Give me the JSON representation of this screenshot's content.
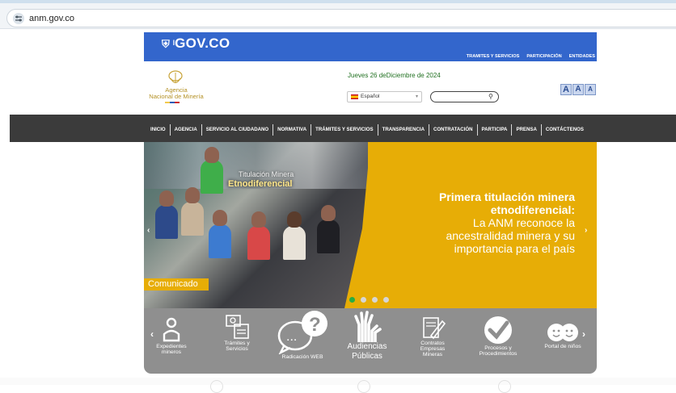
{
  "browser": {
    "url": "anm.gov.co"
  },
  "gov_bar": {
    "logo_text": "GOV.CO",
    "links": [
      "TRAMITES Y SERVICIOS",
      "PARTICIPACIÓN",
      "ENTIDADES"
    ]
  },
  "header": {
    "agency_name_line1": "Agencia",
    "agency_name_line2": "Nacional de Minería",
    "date": "Jueves 26 deDiciembre de 2024",
    "language": "Español",
    "font_sizes": [
      "A",
      "A",
      "A"
    ]
  },
  "nav": {
    "items": [
      "INICIO",
      "AGENCIA",
      "SERVICIO AL CIUDADANO",
      "NORMATIVA",
      "TRÁMITES Y SERVICIOS",
      "TRANSPARENCIA",
      "CONTRATACIÓN",
      "PARTICIPA",
      "PRENSA",
      "CONTÁCTENOS"
    ]
  },
  "banner": {
    "photo_caption": "Titulación Minera",
    "photo_sign": "Etnodiferencial",
    "title_line1": "Primera titulación minera",
    "title_line2": "etnodiferencial:",
    "body_line1": "La ANM reconoce la",
    "body_line2": "ancestralidad minera y su",
    "body_line3": "importancia para el país",
    "badge": "Comunicado"
  },
  "services": [
    {
      "label_lines": [
        "Expedientes",
        "mineros"
      ]
    },
    {
      "label_lines": [
        "Trámites y",
        "Servicios"
      ]
    },
    {
      "label_lines": [
        "Radicación WEB"
      ]
    },
    {
      "label_lines": [
        "Audiencias",
        "Públicas"
      ]
    },
    {
      "label_lines": [
        "Contratos",
        "Empresas",
        "Mineras"
      ]
    },
    {
      "label_lines": [
        "Procesos y",
        "Procedimientos"
      ]
    },
    {
      "label_lines": [
        "Portal de niños"
      ]
    }
  ],
  "colors": {
    "gov_blue": "#3366cc",
    "nav_dark": "#3b3b3b",
    "banner_yellow": "#e7ad06",
    "services_gray": "#8f8f8f",
    "agency_gold": "#b59227",
    "date_green": "#207020"
  }
}
